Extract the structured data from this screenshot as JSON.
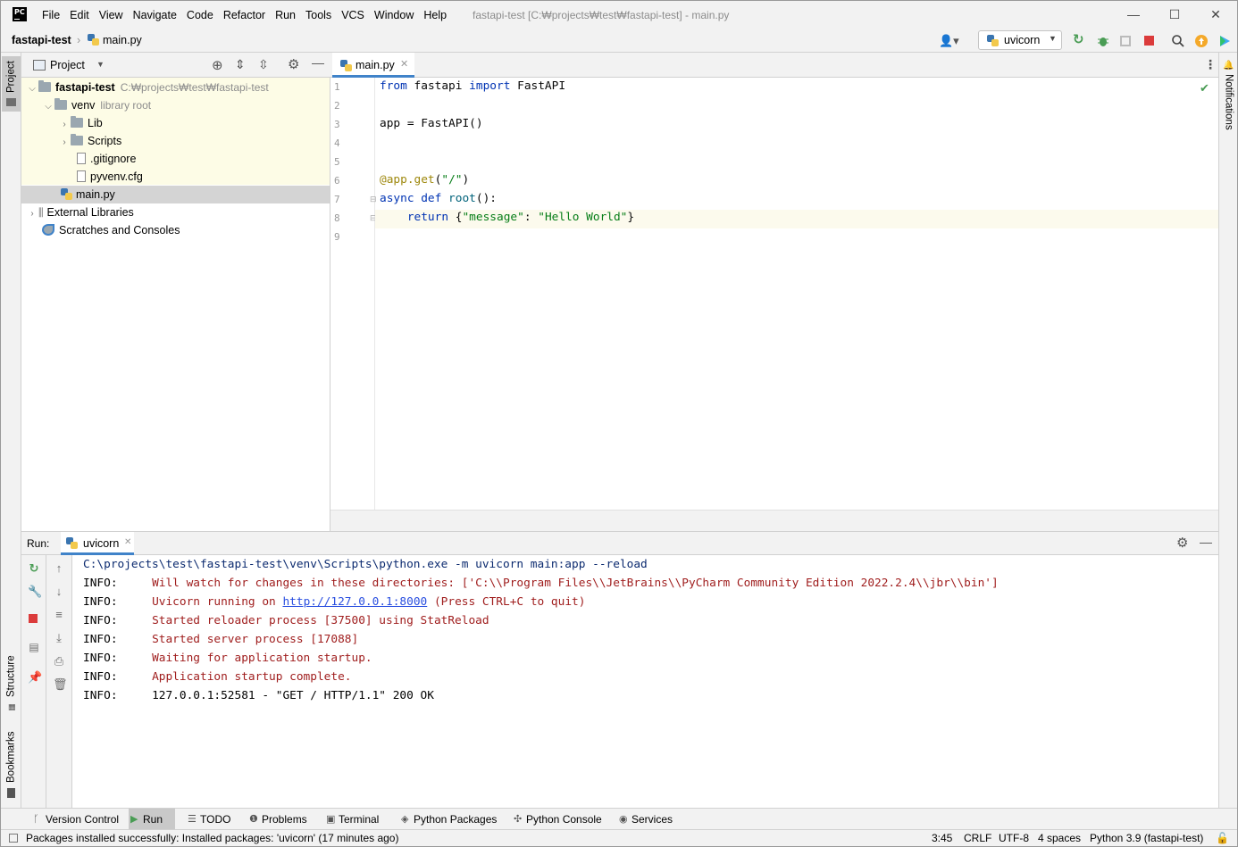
{
  "window": {
    "app_icon_text": "PC",
    "title": "fastapi-test [C:₩projects₩test₩fastapi-test] - main.py",
    "menu": [
      "File",
      "Edit",
      "View",
      "Navigate",
      "Code",
      "Refactor",
      "Run",
      "Tools",
      "VCS",
      "Window",
      "Help"
    ],
    "controls": {
      "minimize": "—",
      "maximize": "☐",
      "close": "✕"
    }
  },
  "navbar": {
    "project": "fastapi-test",
    "file": "main.py",
    "run_config": "uvicorn"
  },
  "left_stripe": {
    "project": "Project",
    "structure": "Structure",
    "bookmarks": "Bookmarks"
  },
  "right_stripe": {
    "notifications": "Notifications"
  },
  "project_panel": {
    "title": "Project",
    "tree": [
      {
        "label": "fastapi-test",
        "hint": "C:₩projects₩test₩fastapi-test"
      },
      {
        "label": "venv",
        "hint": "library root"
      },
      {
        "label": "Lib"
      },
      {
        "label": "Scripts"
      },
      {
        "label": ".gitignore"
      },
      {
        "label": "pyvenv.cfg"
      },
      {
        "label": "main.py"
      },
      {
        "label": "External Libraries"
      },
      {
        "label": "Scratches and Consoles"
      }
    ]
  },
  "editor": {
    "tab": "main.py",
    "line_numbers": [
      "1",
      "2",
      "3",
      "4",
      "5",
      "6",
      "7",
      "8",
      "9"
    ],
    "code": {
      "l1_from": "from",
      "l1_mod": " fastapi ",
      "l1_import": "import",
      "l1_name": " FastAPI",
      "l3": "app = FastAPI()",
      "l6_dec": "@app.get",
      "l6_open": "(",
      "l6_str": "\"/\"",
      "l6_close": ")",
      "l7_kw": "async def",
      "l7_fn": " root",
      "l7_rest": "():",
      "l8_kw": "    return",
      "l8_open": " {",
      "l8_k": "\"message\"",
      "l8_colon": ": ",
      "l8_v": "\"Hello World\"",
      "l8_close": "}"
    }
  },
  "run_panel": {
    "label": "Run:",
    "tab": "uvicorn",
    "console": {
      "cmd": "C:\\projects\\test\\fastapi-test\\venv\\Scripts\\python.exe -m uvicorn main:app --reload",
      "lines": [
        {
          "level": "INFO:",
          "msg": "Will watch for changes in these directories: ['C:\\\\Program Files\\\\JetBrains\\\\PyCharm Community Edition 2022.2.4\\\\jbr\\\\bin']"
        },
        {
          "level": "INFO:",
          "pre": "Uvicorn running on ",
          "link": "http://127.0.0.1:8000",
          "post": " (Press CTRL+C to quit)"
        },
        {
          "level": "INFO:",
          "msg": "Started reloader process [37500] using StatReload"
        },
        {
          "level": "INFO:",
          "msg": "Started server process [17088]"
        },
        {
          "level": "INFO:",
          "msg": "Waiting for application startup."
        },
        {
          "level": "INFO:",
          "msg": "Application startup complete."
        },
        {
          "level": "INFO:",
          "msg": "127.0.0.1:52581 - \"GET / HTTP/1.1\" 200 OK"
        }
      ]
    }
  },
  "tool_tabs": [
    "Version Control",
    "Run",
    "TODO",
    "Problems",
    "Terminal",
    "Python Packages",
    "Python Console",
    "Services"
  ],
  "status": {
    "message": "Packages installed successfully: Installed packages: 'uvicorn' (17 minutes ago)",
    "position": "3:45",
    "line_sep": "CRLF",
    "encoding": "UTF-8",
    "indent": "4 spaces",
    "interpreter": "Python 3.9 (fastapi-test)"
  },
  "colors": {
    "accent": "#4083c9",
    "keyword": "#0033b3",
    "string": "#067d17",
    "decorator": "#9e880d",
    "console_info": "#9f1c1c",
    "stop": "#db3b3b",
    "run": "#499c54"
  }
}
